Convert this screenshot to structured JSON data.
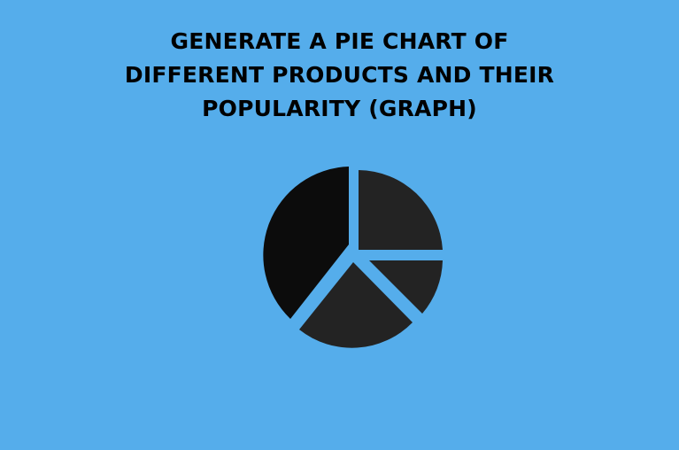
{
  "title_lines": [
    "GENERATE A PIE CHART OF",
    "DIFFERENT PRODUCTS AND THEIR",
    "POPULARITY (GRAPH)"
  ],
  "colors": {
    "background": "#55adeb",
    "text": "#000000",
    "slice_dark": "#0c0c0c",
    "slice_mid": "#232323"
  },
  "icon": "pie-chart-icon"
}
